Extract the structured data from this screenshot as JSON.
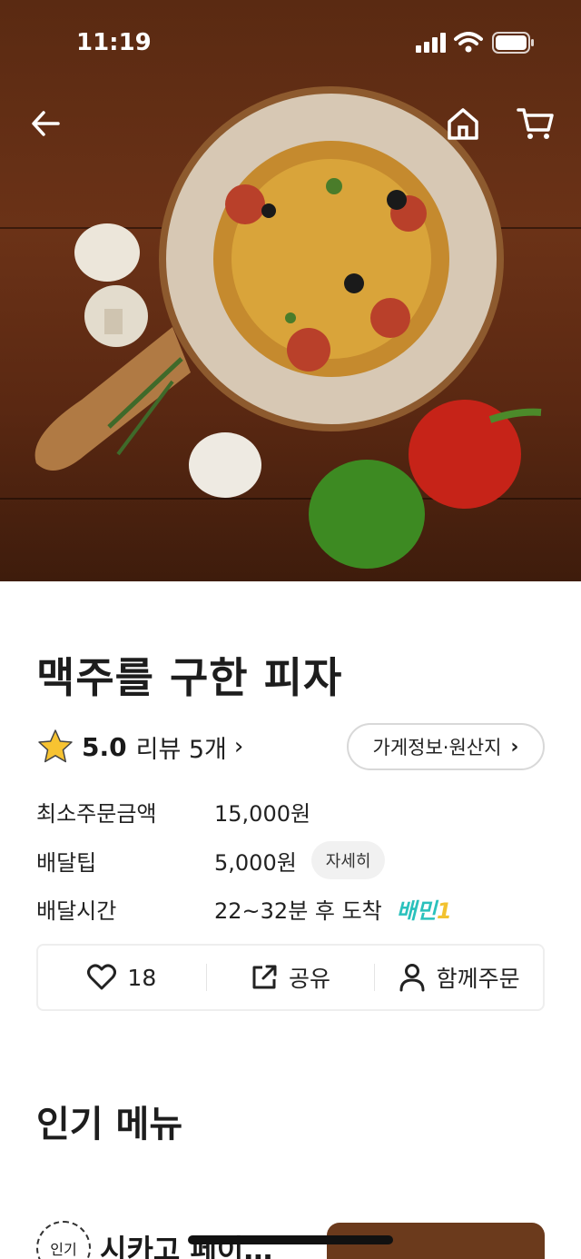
{
  "status_bar": {
    "time": "11:19"
  },
  "store": {
    "name": "맥주를 구한 피자",
    "rating": "5.0",
    "reviews_label": "리뷰 5개",
    "info_button_label": "가게정보·원산지"
  },
  "details": {
    "min_order_label": "최소주문금액",
    "min_order_value": "15,000원",
    "delivery_tip_label": "배달팁",
    "delivery_tip_value": "5,000원",
    "delivery_tip_detail": "자세히",
    "delivery_time_label": "배달시간",
    "delivery_time_value": "22~32분 후 도착",
    "badge_text": "배민",
    "badge_number": "1"
  },
  "actions": {
    "like_count": "18",
    "share_label": "공유",
    "group_order_label": "함께주문"
  },
  "section": {
    "popular_title": "인기 메뉴"
  },
  "menu_peek": {
    "badge": "인기",
    "name": "시카고 페이…"
  },
  "colors": {
    "accent_teal": "#2ac1bc",
    "accent_yellow": "#f2c230",
    "star": "#f7c331"
  }
}
